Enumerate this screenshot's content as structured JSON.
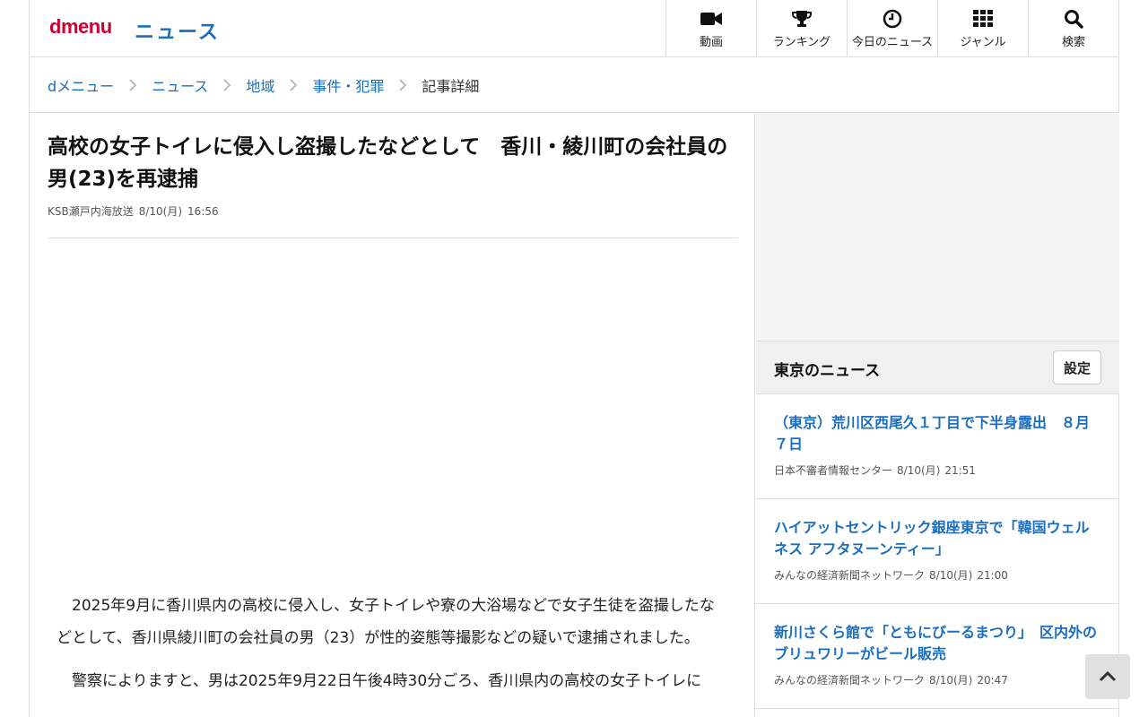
{
  "header": {
    "logo_d": "d",
    "logo_menu": "menu",
    "section": "ニュース",
    "nav": [
      {
        "label": "動画",
        "icon": "video-camera-icon"
      },
      {
        "label": "ランキング",
        "icon": "trophy-icon"
      },
      {
        "label": "今日のニュース",
        "icon": "clock-icon"
      },
      {
        "label": "ジャンル",
        "icon": "grid-icon"
      },
      {
        "label": "検索",
        "icon": "search-icon"
      }
    ]
  },
  "breadcrumb": [
    "dメニュー",
    "ニュース",
    "地域",
    "事件・犯罪",
    "記事詳細"
  ],
  "article": {
    "title": "高校の女子トイレに侵入し盗撮したなどとして　香川・綾川町の会社員の男(23)を再逮捕",
    "source": "KSB瀬戸内海放送",
    "date": "8/10(月)",
    "time": "16:56",
    "paragraphs": [
      "2025年9月に香川県内の高校に侵入し、女子トイレや寮の大浴場などで女子生徒を盗撮したなどとして、香川県綾川町の会社員の男（23）が性的姿態等撮影などの疑いで逮捕されました。",
      "警察によりますと、男は2025年9月22日午後4時30分ごろ、香川県内の高校の女子トイレに"
    ]
  },
  "sidebar": {
    "title": "東京のニュース",
    "settings_label": "設定",
    "items": [
      {
        "title": "（東京）荒川区西尾久１丁目で下半身露出　８月７日",
        "source": "日本不審者情報センター",
        "date": "8/10(月)",
        "time": "21:51"
      },
      {
        "title": "ハイアットセントリック銀座東京で「韓国ウェルネス アフタヌーンティー」",
        "source": "みんなの経済新聞ネットワーク",
        "date": "8/10(月)",
        "time": "21:00"
      },
      {
        "title": "新川さくら館で「ともにびーるまつり」　区内外のブリュワリーがビール販売",
        "source": "みんなの経済新聞ネットワーク",
        "date": "8/10(月)",
        "time": "20:47"
      }
    ]
  },
  "colors": {
    "brand_red": "#cc0033",
    "link_blue": "#1a6ebd"
  }
}
